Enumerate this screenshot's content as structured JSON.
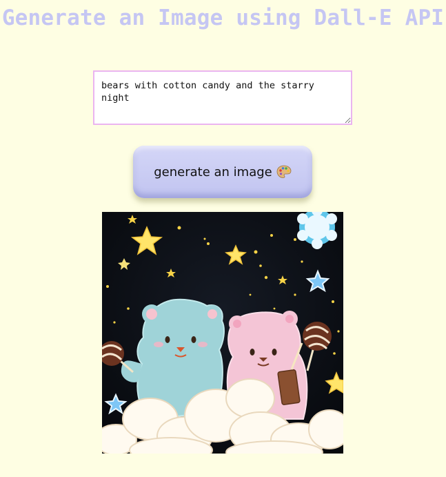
{
  "header": {
    "title": "Generate an Image using Dall-E API"
  },
  "form": {
    "prompt_value": "bears with cotton candy and the starry night",
    "submit_label": "generate an image",
    "submit_icon": "palette-icon"
  },
  "result": {
    "image_subject": "bears-cotton-candy-starry-night"
  }
}
